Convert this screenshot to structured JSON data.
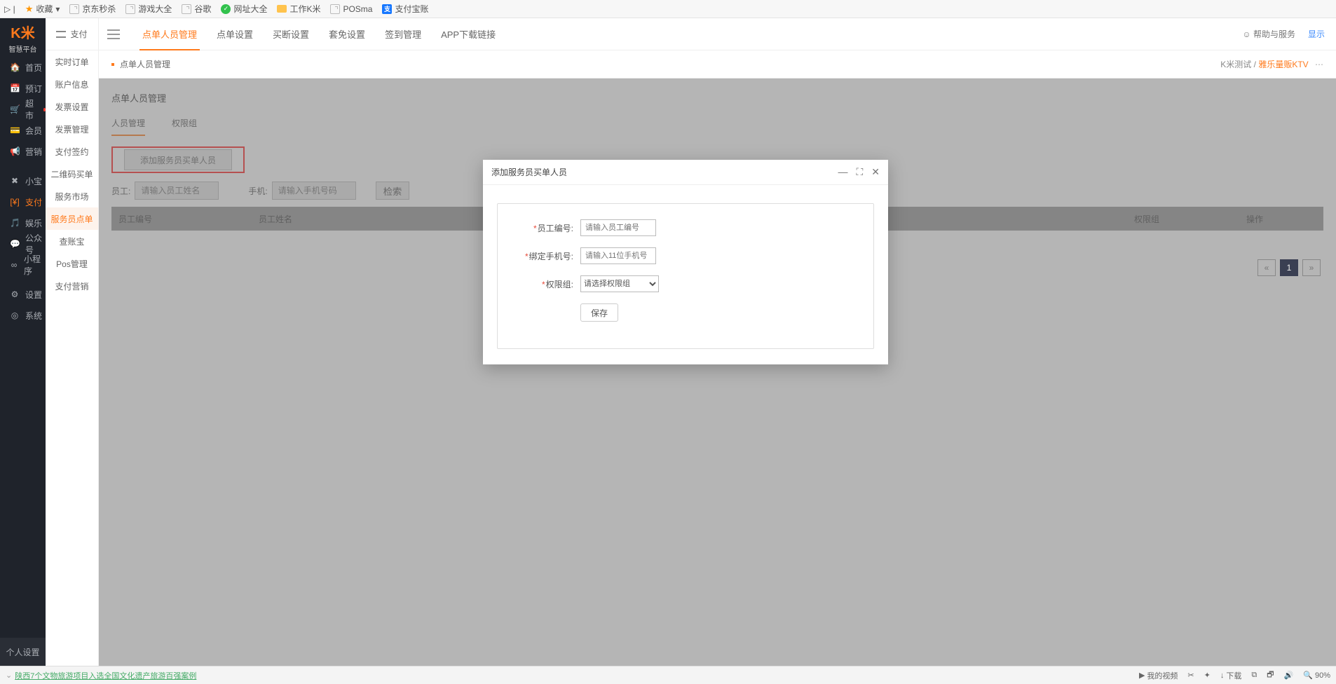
{
  "bookmarks": {
    "fav": "收藏",
    "items": [
      "京东秒杀",
      "游戏大全",
      "谷歌",
      "网址大全",
      "工作K米",
      "POSma",
      "支付宝账"
    ]
  },
  "leftRail": {
    "logo": "K米",
    "logoSub": "智慧平台",
    "items": [
      {
        "icon": "🏠",
        "label": "首页"
      },
      {
        "icon": "📅",
        "label": "预订"
      },
      {
        "icon": "🛒",
        "label": "超市",
        "dot": true
      },
      {
        "icon": "💳",
        "label": "会员"
      },
      {
        "icon": "📢",
        "label": "营销"
      },
      {
        "icon": "✖",
        "label": "小宝"
      },
      {
        "icon": "[¥]",
        "label": "支付",
        "active": true
      },
      {
        "icon": "🎵",
        "label": "娱乐"
      },
      {
        "icon": "💬",
        "label": "公众号"
      },
      {
        "icon": "∞",
        "label": "小程序"
      },
      {
        "icon": "⚙",
        "label": "设置"
      },
      {
        "icon": "◎",
        "label": "系统"
      }
    ],
    "bottom": "个人设置"
  },
  "subNav": {
    "header": "支付",
    "items": [
      "实时订单",
      "账户信息",
      "发票设置",
      "发票管理",
      "支付签约",
      "二维码买单",
      "服务市场",
      "服务员点单",
      "查账宝",
      "Pos管理",
      "支付营销"
    ],
    "activeIndex": 7
  },
  "topTabs": {
    "items": [
      "点单人员管理",
      "点单设置",
      "买断设置",
      "套免设置",
      "签到管理",
      "APP下载链接"
    ],
    "activeIndex": 0,
    "help": "帮助与服务",
    "show": "显示"
  },
  "crumb": {
    "title": "点单人员管理",
    "org": "K米测试 /",
    "ktv": "雅乐量贩KTV"
  },
  "panel": {
    "title": "点单人员管理",
    "tabs": [
      "人员管理",
      "权限组"
    ],
    "activeTab": 0,
    "addBtn": "添加服务员买单人员",
    "filterStaffLabel": "员工:",
    "filterStaffPh": "请输入员工姓名",
    "filterPhoneLabel": "手机:",
    "filterPhonePh": "请输入手机号码",
    "searchBtn": "检索",
    "cols": [
      "员工编号",
      "员工姓名",
      "权限组",
      "操作"
    ]
  },
  "pager": {
    "prev": "«",
    "page": "1",
    "next": "»"
  },
  "modal": {
    "title": "添加服务员买单人员",
    "f1Label": "员工编号:",
    "f1Ph": "请输入员工编号",
    "f2Label": "绑定手机号:",
    "f2Ph": "请输入11位手机号",
    "f3Label": "权限组:",
    "f3Option": "请选择权限组",
    "save": "保存"
  },
  "taskbar": {
    "news": "陕西7个文物旅游项目入选全国文化遗产旅游百强案例",
    "videos": "我的视频",
    "download": "下载",
    "zoom": "90%"
  }
}
